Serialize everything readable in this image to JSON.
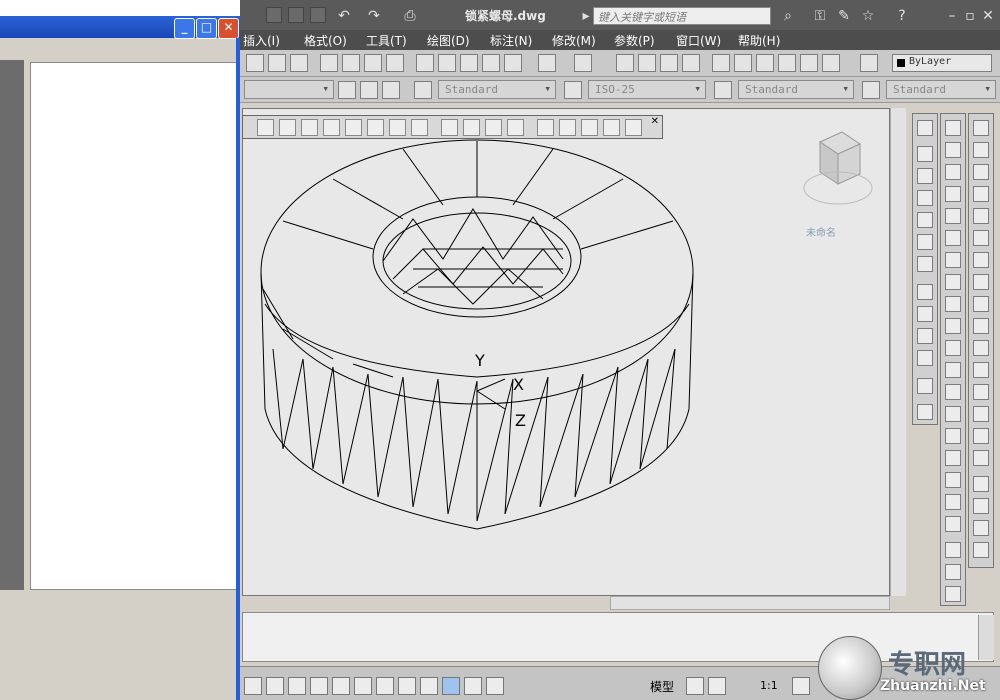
{
  "window": {
    "doc_title": "锁紧螺母.dwg",
    "search_placeholder": "键入关键字或短语"
  },
  "menu": [
    "插入(I)",
    "格式(O)",
    "工具(T)",
    "绘图(D)",
    "标注(N)",
    "修改(M)",
    "参数(P)",
    "窗口(W)",
    "帮助(H)"
  ],
  "toolbar": {
    "text_style": "Standard",
    "dim_style": "ISO-25",
    "table_style": "Standard",
    "mleader_style": "Standard",
    "layer": "ByLayer"
  },
  "viewport": {
    "ucs_y": "Y",
    "ucs_x": "X",
    "ucs_z": "Z",
    "view_name": "未命名"
  },
  "statusbar": {
    "model_label": "模型",
    "scale": "1:1"
  },
  "watermark": {
    "title": "专职网",
    "url": "Zhuanzhi.Net"
  },
  "colors": {
    "title_bar": "#5a5a5a",
    "menu_bar": "#4d4d4d",
    "drawing_bg": "#e8e8e8",
    "xp_blue": "#245edb"
  }
}
